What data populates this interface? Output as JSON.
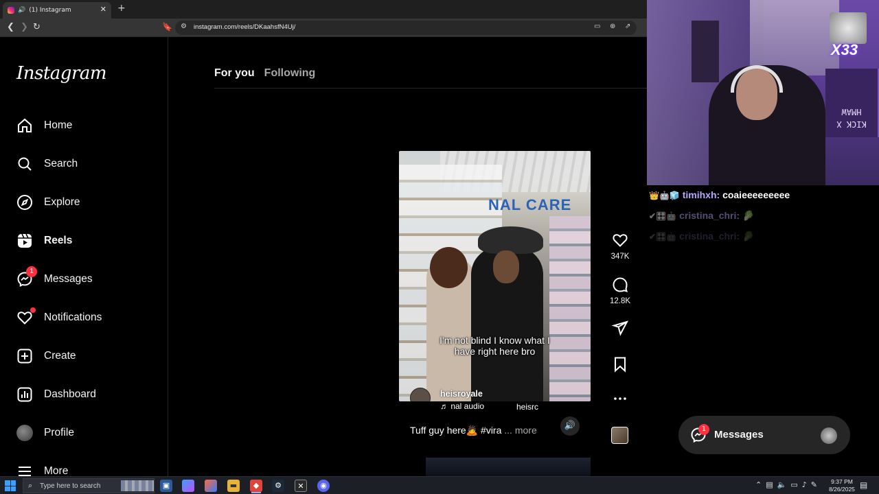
{
  "browser": {
    "tab_title": "(1) Instagram",
    "new_tab": "+",
    "close": "✕",
    "url": "instagram.com/reels/DKaahsfN4Uj/"
  },
  "sidebar": {
    "logo": "Instagram",
    "items": [
      {
        "label": "Home",
        "icon": "home-icon"
      },
      {
        "label": "Search",
        "icon": "search-icon"
      },
      {
        "label": "Explore",
        "icon": "compass-icon"
      },
      {
        "label": "Reels",
        "icon": "reels-icon",
        "active": true
      },
      {
        "label": "Messages",
        "icon": "messenger-icon",
        "badge": "1"
      },
      {
        "label": "Notifications",
        "icon": "heart-icon",
        "dot": true
      },
      {
        "label": "Create",
        "icon": "plus-square-icon"
      },
      {
        "label": "Dashboard",
        "icon": "chart-icon"
      },
      {
        "label": "Profile",
        "icon": "avatar"
      },
      {
        "label": "More",
        "icon": "menu-icon"
      }
    ]
  },
  "feed": {
    "tabs": [
      "For you",
      "Following"
    ],
    "active_tab": "For you"
  },
  "reel": {
    "caption_overlay_line1": "I'm not blind I know what I",
    "caption_overlay_line2": "have right here bro",
    "store_sign": "NAL CARE",
    "author": "heisroyale",
    "audio": "♬ nal audio",
    "audio_user": "heisrc",
    "description": "Tuff guy here🙇 #vira",
    "more": "... more",
    "likes": "347K",
    "comments": "12.8K"
  },
  "stream_overlay": {
    "gift_counter": "X33",
    "webcam_banner": "KICK X HMAW",
    "chat": [
      {
        "icons": "👑🤖🧊",
        "user": "timihxh:",
        "message": "coaieeeeeeeee"
      },
      {
        "icons": "✔🎛🤖",
        "user": "cristina_chri:",
        "message": "🥬"
      },
      {
        "icons": "✔🎛🤖",
        "user": "cristina_chri:",
        "message": "🥬"
      }
    ]
  },
  "messages_pill": {
    "label": "Messages",
    "badge": "1"
  },
  "taskbar": {
    "search_placeholder": "Type here to search",
    "time": "9:37 PM",
    "date": "8/26/2025"
  },
  "colors": {
    "background": "#000000",
    "badge_red": "#ff3040",
    "chat_user": "#b6aaff",
    "secondary_text": "#a8a8a8"
  }
}
